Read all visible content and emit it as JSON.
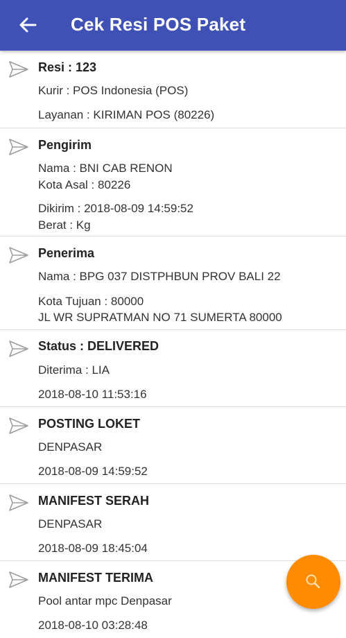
{
  "app": {
    "title": "Cek Resi POS Paket",
    "back_icon": "arrow-left-icon",
    "accent_color": "#3f51b5",
    "fab_color": "#ff8c00",
    "fab_icon": "search-icon"
  },
  "cards": [
    {
      "icon": "send-icon",
      "title": "Resi : 123",
      "lines": [
        "Kurir : POS Indonesia (POS)",
        "Layanan : KIRIMAN POS (80226)"
      ]
    },
    {
      "icon": "send-icon",
      "title": "Pengirim",
      "lines": [
        "Nama : BNI CAB RENON",
        "Kota Asal : 80226",
        "Dikirim : 2018-08-09 14:59:52",
        "Berat :  Kg"
      ]
    },
    {
      "icon": "send-icon",
      "title": "Penerima",
      "lines": [
        "Nama : BPG 037 DISTPHBUN PROV BALI 22",
        "Kota Tujuan : 80000",
        "JL WR SUPRATMAN NO 71 SUMERTA 80000"
      ]
    },
    {
      "icon": "send-icon",
      "title": "Status : DELIVERED",
      "lines": [
        "Diterima : LIA",
        "2018-08-10 11:53:16"
      ]
    },
    {
      "icon": "send-icon",
      "title": "POSTING LOKET",
      "lines": [
        "DENPASAR",
        "2018-08-09 14:59:52"
      ]
    },
    {
      "icon": "send-icon",
      "title": "MANIFEST SERAH",
      "lines": [
        "DENPASAR",
        "2018-08-09 18:45:04"
      ]
    },
    {
      "icon": "send-icon",
      "title": "MANIFEST TERIMA",
      "lines": [
        "Pool antar mpc Denpasar",
        "2018-08-10 03:28:48"
      ]
    }
  ]
}
